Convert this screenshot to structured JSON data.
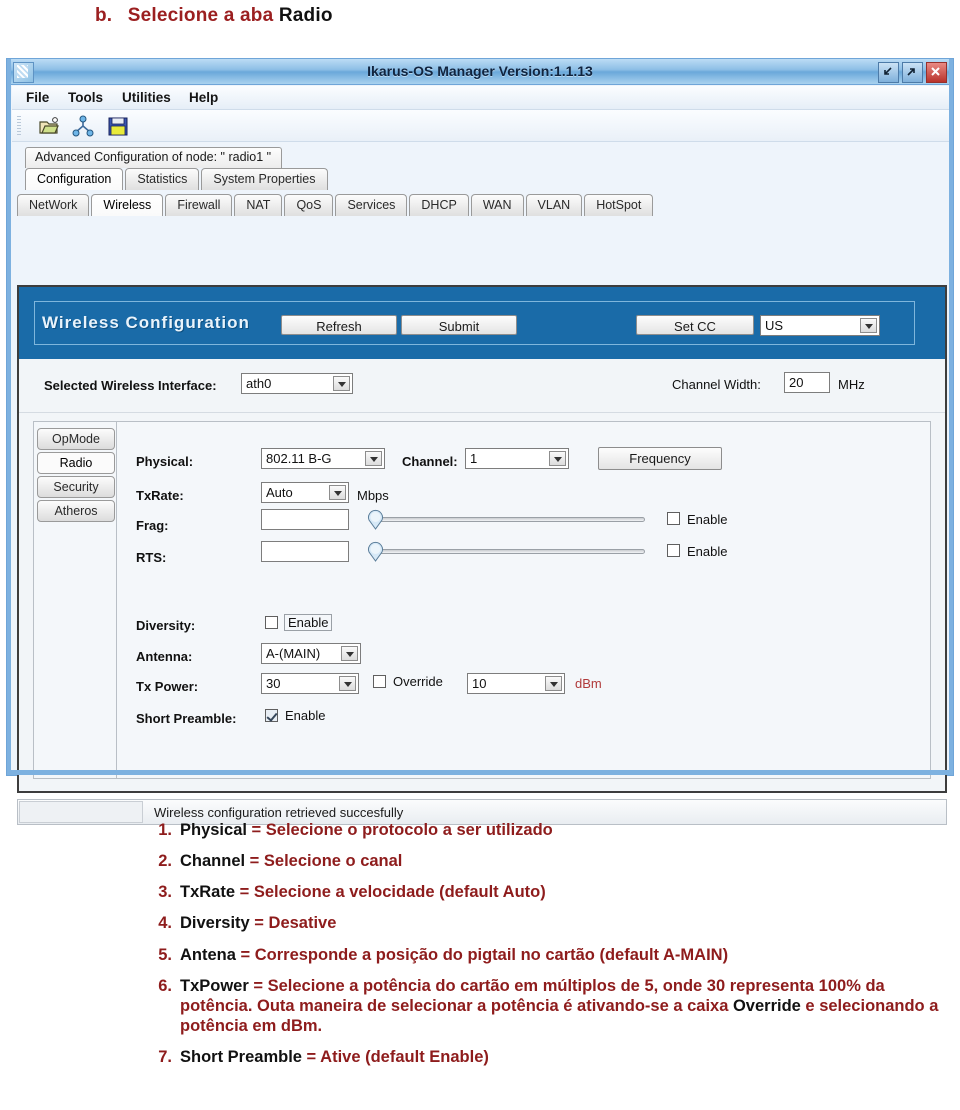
{
  "heading": {
    "marker": "b.",
    "lead": "Selecione a aba ",
    "emphasis": "Radio"
  },
  "window": {
    "title": "Ikarus-OS Manager   Version:1.1.13",
    "app_icon": "app-logo-icon",
    "controls": {
      "minimize": "minimize-icon",
      "maximize": "maximize-icon",
      "close": "close-icon"
    }
  },
  "menubar": {
    "items": [
      "File",
      "Tools",
      "Utilities",
      "Help"
    ]
  },
  "toolbar": {
    "icons": [
      "open-folder-icon",
      "network-node-icon",
      "save-disk-icon"
    ]
  },
  "node_label": "Advanced Configuration of node:  \" radio1 \"",
  "primary_tabs": {
    "items": [
      "Configuration",
      "Statistics",
      "System Properties"
    ],
    "active": "Configuration"
  },
  "secondary_tabs": {
    "items": [
      "NetWork",
      "Wireless",
      "Firewall",
      "NAT",
      "QoS",
      "Services",
      "DHCP",
      "WAN",
      "VLAN",
      "HotSpot"
    ],
    "active": "Wireless"
  },
  "wireless_panel": {
    "title": "Wireless Configuration",
    "refresh_label": "Refresh",
    "submit_label": "Submit",
    "setcc_label": "Set CC",
    "country_code": "US",
    "interface_label": "Selected Wireless Interface:",
    "interface_value": "ath0",
    "channel_width_label": "Channel Width:",
    "channel_width_value": "20",
    "channel_width_unit": "MHz"
  },
  "vertical_tabs": {
    "items": [
      "OpMode",
      "Radio",
      "Security",
      "Atheros"
    ],
    "active": "Radio"
  },
  "radio_form": {
    "physical_label": "Physical:",
    "physical_value": "802.11 B-G",
    "channel_label": "Channel:",
    "channel_value": "1",
    "frequency_button": "Frequency",
    "txrate_label": "TxRate:",
    "txrate_value": "Auto",
    "txrate_unit": "Mbps",
    "frag_label": "Frag:",
    "frag_value": "",
    "frag_enable_label": "Enable",
    "frag_enabled": false,
    "rts_label": "RTS:",
    "rts_value": "",
    "rts_enable_label": "Enable",
    "rts_enabled": false,
    "diversity_label": "Diversity:",
    "diversity_enable_label": "Enable",
    "diversity_enabled": false,
    "antenna_label": "Antenna:",
    "antenna_value": "A-(MAIN)",
    "txpower_label": "Tx Power:",
    "txpower_value": "30",
    "override_label": "Override",
    "override_enabled": false,
    "override_value": "10",
    "override_unit": "dBm",
    "short_preamble_label": "Short Preamble:",
    "short_preamble_enable_label": "Enable",
    "short_preamble_enabled": true
  },
  "statusbar": {
    "message": "Wireless configuration retrieved succesfully"
  },
  "notes": [
    {
      "num": "1.",
      "term": "Physical",
      "eq": " = ",
      "text": "Selecione o protocolo a ser utilizado"
    },
    {
      "num": "2.",
      "term": "Channel",
      "eq": " = ",
      "text": "Selecione o canal"
    },
    {
      "num": "3.",
      "term": "TxRate",
      "eq": " = ",
      "text": "Selecione a velocidade (default Auto)"
    },
    {
      "num": "4.",
      "term": "Diversity",
      "eq": " = ",
      "text": "Desative"
    },
    {
      "num": "5.",
      "term": "Antena",
      "eq": " = ",
      "text": "Corresponde a posição do pigtail no cartão (default A-MAIN)"
    },
    {
      "num": "6.",
      "term": "TxPower",
      "eq": " = ",
      "text": "Selecione a potência do cartão em múltiplos de 5, onde 30 representa 100% da potência. Outa maneira de selecionar a potência é ativando-se a caixa ",
      "term2": "Override",
      "text2": " e selecionando a potência em dBm."
    },
    {
      "num": "7.",
      "term": "Short Preamble",
      "eq": " = ",
      "text": "Ative (default Enable)"
    }
  ],
  "colors": {
    "accent_red": "#8e1c1c",
    "panel_blue": "#1a6ba8",
    "title_blue": "#8ebfe6",
    "dbm_red": "#b03a3a"
  }
}
